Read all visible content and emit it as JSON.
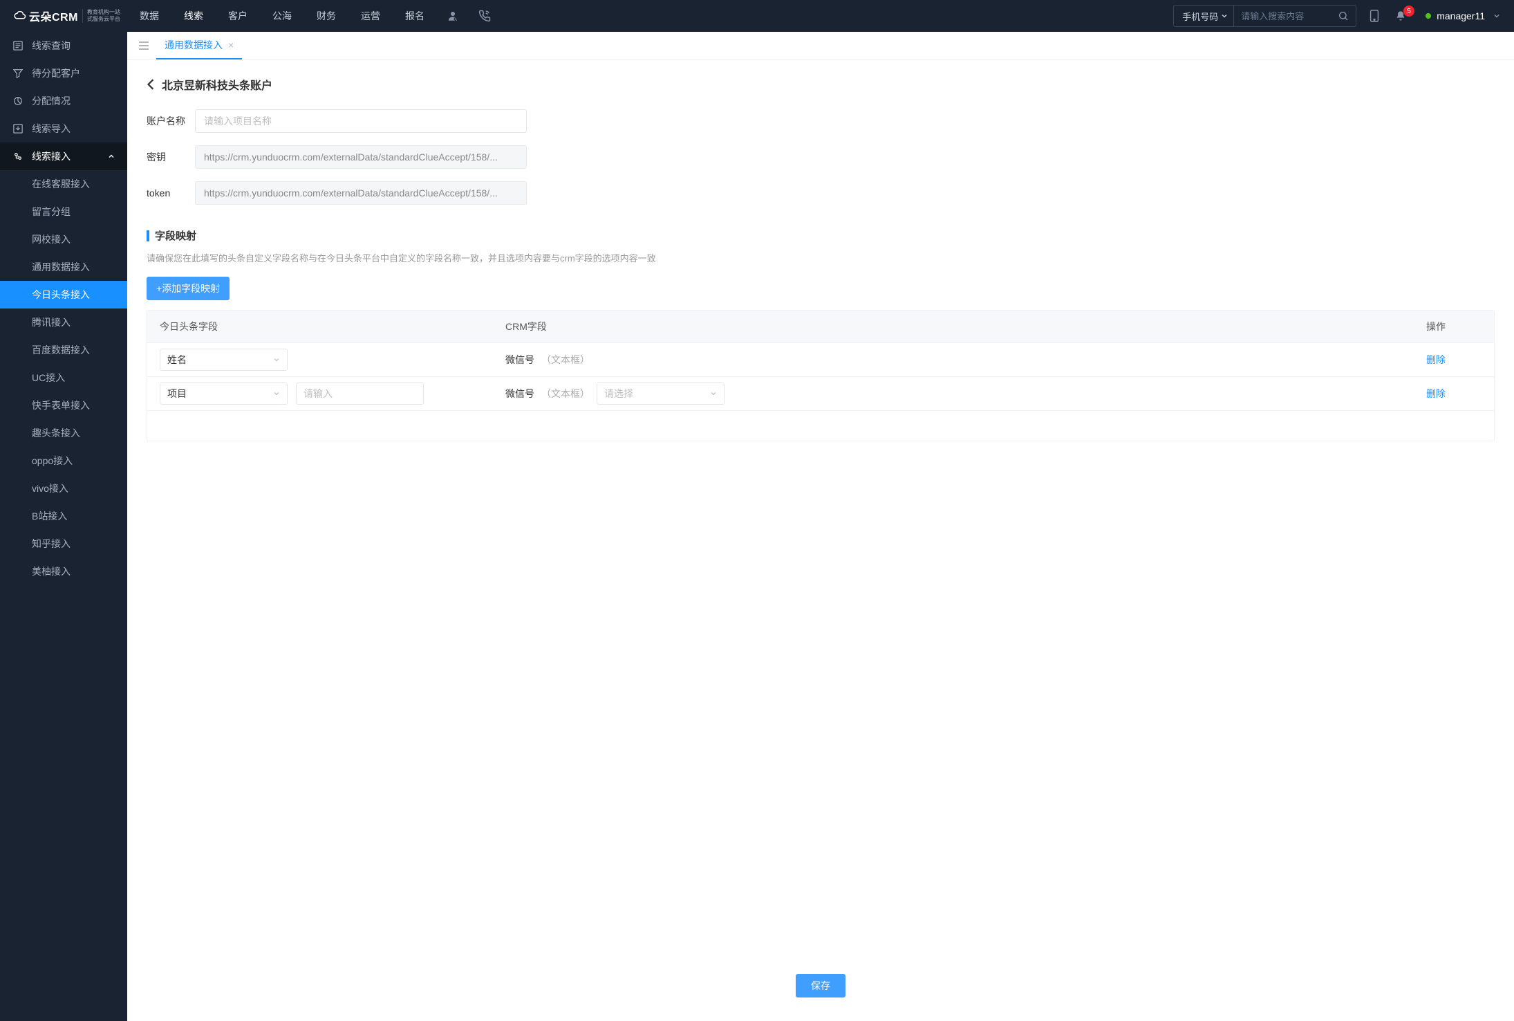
{
  "header": {
    "logo_main": "云朵CRM",
    "logo_sub1": "教育机构一站",
    "logo_sub2": "式服务云平台",
    "nav": [
      "数据",
      "线索",
      "客户",
      "公海",
      "财务",
      "运营",
      "报名"
    ],
    "active_nav_index": 1,
    "search_type": "手机号码",
    "search_placeholder": "请输入搜索内容",
    "badge": "5",
    "user": "manager11"
  },
  "sidebar": {
    "items": [
      {
        "label": "线索查询",
        "icon": "list"
      },
      {
        "label": "待分配客户",
        "icon": "filter"
      },
      {
        "label": "分配情况",
        "icon": "pie"
      },
      {
        "label": "线索导入",
        "icon": "import"
      },
      {
        "label": "线索接入",
        "icon": "plug",
        "expanded": true
      }
    ],
    "sub_items": [
      "在线客服接入",
      "留言分组",
      "网校接入",
      "通用数据接入",
      "今日头条接入",
      "腾讯接入",
      "百度数据接入",
      "UC接入",
      "快手表单接入",
      "趣头条接入",
      "oppo接入",
      "vivo接入",
      "B站接入",
      "知乎接入",
      "美柚接入"
    ],
    "active_sub_index": 4
  },
  "tabs": {
    "items": [
      "通用数据接入"
    ],
    "active_index": 0
  },
  "page": {
    "breadcrumb": "北京昱新科技头条账户",
    "form": {
      "name_label": "账户名称",
      "name_ph": "请输入项目名称",
      "name_value": "",
      "key_label": "密钥",
      "key_value": "https://crm.yunduocrm.com/externalData/standardClueAccept/158/...",
      "token_label": "token",
      "token_value": "https://crm.yunduocrm.com/externalData/standardClueAccept/158/..."
    },
    "section_title": "字段映射",
    "section_desc": "请确保您在此填写的头条自定义字段名称与在今日头条平台中自定义的字段名称一致，并且选项内容要与crm字段的选项内容一致",
    "add_btn": "+添加字段映射",
    "table": {
      "headers": [
        "今日头条字段",
        "CRM字段",
        "操作"
      ],
      "rows": [
        {
          "field_select": "姓名",
          "extra_input": null,
          "crm_label": "微信号",
          "crm_hint": "（文本框）",
          "crm_select": null,
          "action": "删除"
        },
        {
          "field_select": "项目",
          "extra_input_ph": "请输入",
          "extra_input": "",
          "crm_label": "微信号",
          "crm_hint": "（文本框）",
          "crm_select_ph": "请选择",
          "crm_select": "",
          "action": "删除"
        }
      ]
    },
    "save_btn": "保存"
  }
}
